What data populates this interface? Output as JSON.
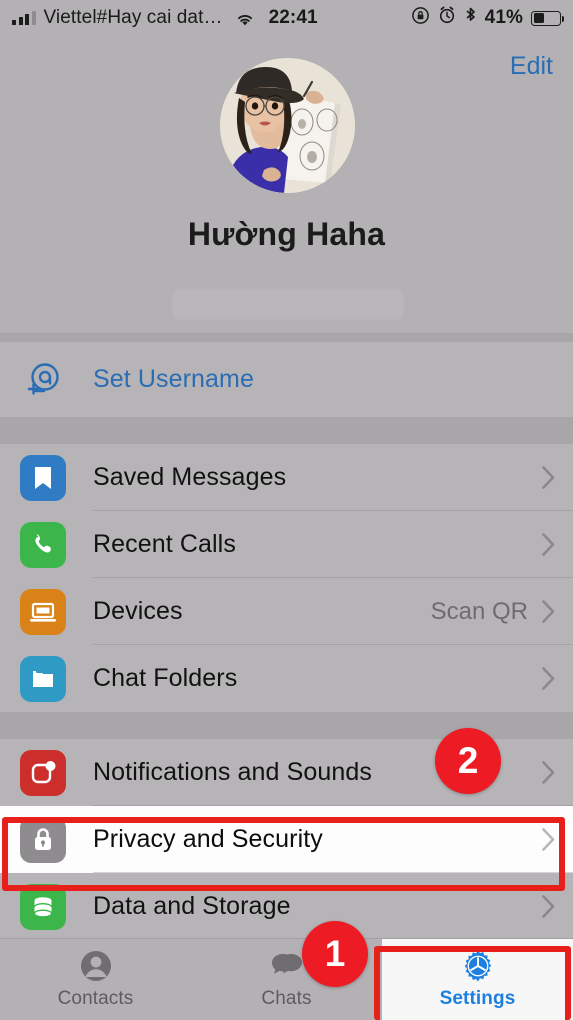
{
  "status_bar": {
    "carrier": "Viettel#Hay cai dat…",
    "time": "22:41",
    "battery_percent": "41%",
    "icons": [
      "signal-bars-icon",
      "wifi-icon",
      "rotation-lock-icon",
      "alarm-clock-icon",
      "bluetooth-icon",
      "battery-icon"
    ]
  },
  "profile": {
    "edit_label": "Edit",
    "name": "Hường Haha",
    "avatar_alt": "user-avatar-photo",
    "phone_redacted": ""
  },
  "username_row": {
    "label": "Set Username",
    "icon": "at-sign-plus-icon"
  },
  "group_main": [
    {
      "label": "Saved Messages",
      "icon": "bookmark-icon",
      "color": "#2f7cc4",
      "value": ""
    },
    {
      "label": "Recent Calls",
      "icon": "phone-icon",
      "color": "#3cb64a",
      "value": ""
    },
    {
      "label": "Devices",
      "icon": "laptop-icon",
      "color": "#d98218",
      "value": "Scan QR"
    },
    {
      "label": "Chat Folders",
      "icon": "folder-icon",
      "color": "#2f9bc4",
      "value": ""
    }
  ],
  "group_settings": [
    {
      "label": "Notifications and Sounds",
      "icon": "notification-bell-icon",
      "color": "#cc2f2b",
      "value": "",
      "highlighted": false
    },
    {
      "label": "Privacy and Security",
      "icon": "lock-icon",
      "color": "#8e8c8e",
      "value": "",
      "highlighted": true
    },
    {
      "label": "Data and Storage",
      "icon": "database-icon",
      "color": "#3cb64a",
      "value": "",
      "highlighted": false
    }
  ],
  "tabs": [
    {
      "label": "Contacts",
      "icon": "person-circle-icon",
      "active": false
    },
    {
      "label": "Chats",
      "icon": "chat-bubbles-icon",
      "active": false
    },
    {
      "label": "Settings",
      "icon": "gear-icon",
      "active": true
    }
  ],
  "annotations": {
    "badge_one": "1",
    "badge_two": "2",
    "accent_color": "#ed1b23",
    "highlight_border_color": "#e8201b"
  }
}
